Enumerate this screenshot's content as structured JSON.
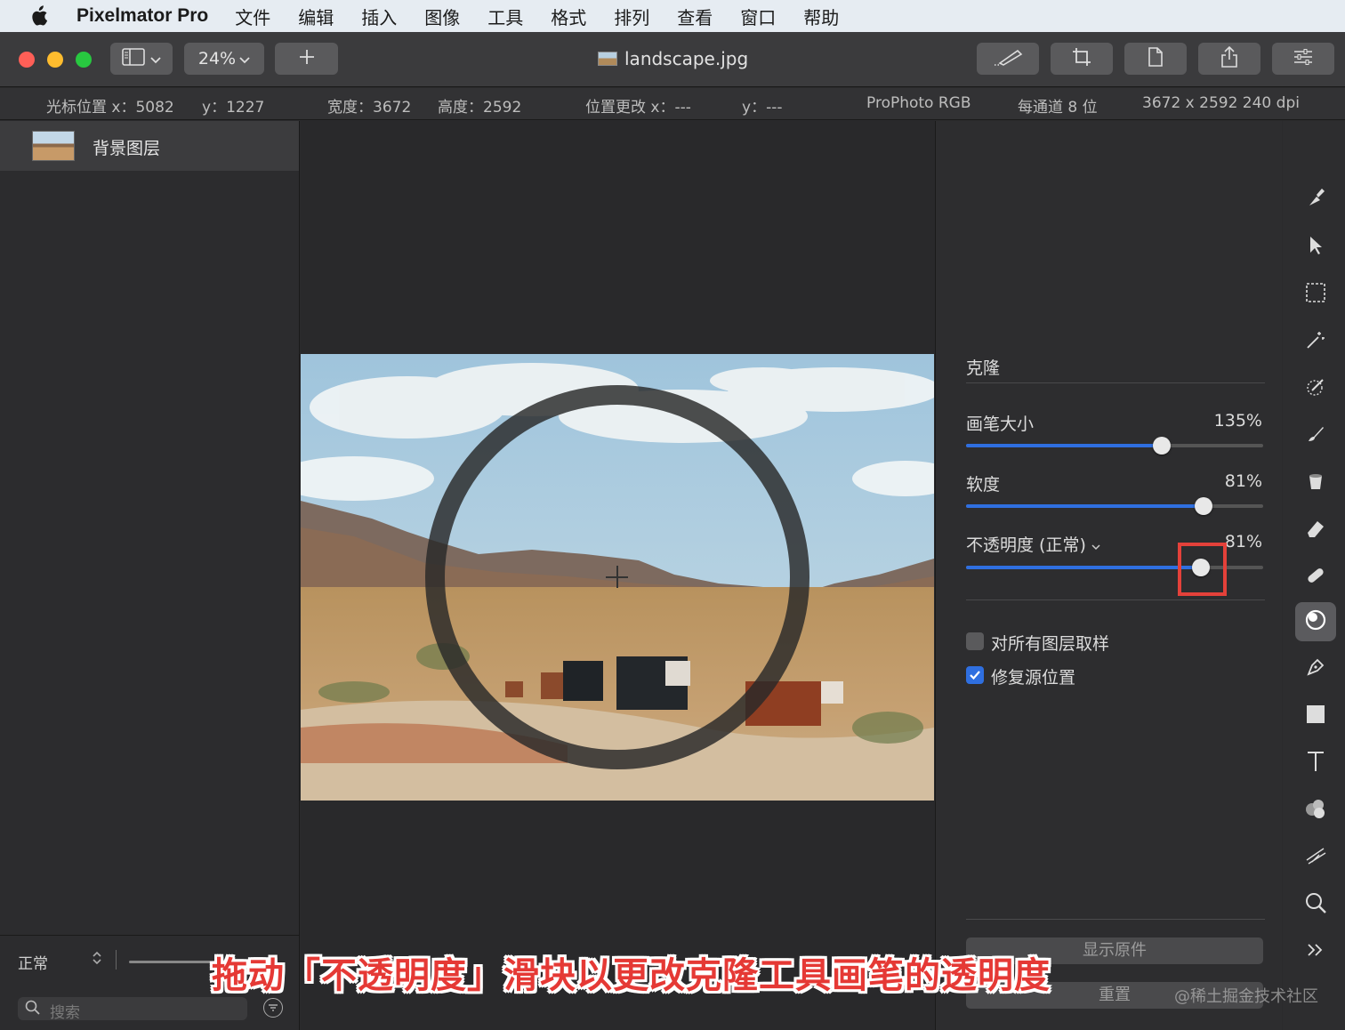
{
  "menubar": {
    "app_name": "Pixelmator Pro",
    "items": [
      "文件",
      "编辑",
      "插入",
      "图像",
      "工具",
      "格式",
      "排列",
      "查看",
      "窗口",
      "帮助"
    ]
  },
  "toolbar": {
    "zoom": "24%",
    "document_title": "landscape.jpg"
  },
  "info": {
    "cursor_x_label": "光标位置 x",
    "cursor_x": "5082",
    "cursor_y_label": "y",
    "cursor_y": "1227",
    "width_label": "宽度",
    "width": "3672",
    "height_label": "高度",
    "height": "2592",
    "pos_change_x_label": "位置更改 x",
    "pos_change_x": "---",
    "pos_change_y_label": "y",
    "pos_change_y": "---",
    "color_profile": "ProPhoto RGB",
    "bit_depth": "每通道 8 位",
    "dimensions": "3672 x 2592 240 dpi"
  },
  "layers": {
    "items": [
      {
        "name": "背景图层"
      }
    ],
    "blend_mode": "正常",
    "search_placeholder": "搜索"
  },
  "clone_panel": {
    "title": "克隆",
    "brush_size_label": "画笔大小",
    "brush_size_value": "135%",
    "brush_size_fraction": 0.66,
    "softness_label": "软度",
    "softness_value": "81%",
    "softness_fraction": 0.8,
    "opacity_label": "不透明度 (正常)",
    "opacity_value": "81%",
    "opacity_fraction": 0.79,
    "sample_all_layers_label": "对所有图层取样",
    "sample_all_layers_checked": false,
    "fix_source_label": "修复源位置",
    "fix_source_checked": true,
    "show_original_label": "显示原件",
    "reset_label": "重置"
  },
  "caption": "拖动「不透明度」滑块以更改克隆工具画笔的透明度",
  "watermark": "@稀土掘金技术社区",
  "colors": {
    "accent": "#2f6fe0",
    "highlight": "#e4413a",
    "close": "#fe5f57",
    "minimize": "#febc2e",
    "zoom": "#28c840"
  }
}
